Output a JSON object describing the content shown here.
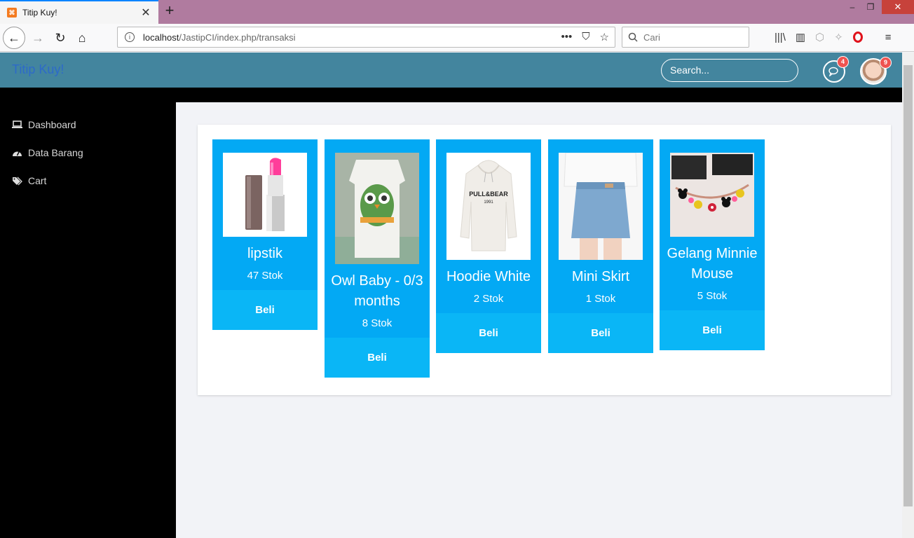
{
  "browser": {
    "tab_title": "Titip Kuy!",
    "url_host": "localhost",
    "url_path": "/JastipCI/index.php/transaksi",
    "search_placeholder": "Cari"
  },
  "app": {
    "brand": "Titip Kuy!",
    "search_placeholder": "Search...",
    "chat_badge": "4",
    "notif_badge": "9"
  },
  "sidebar": {
    "items": [
      {
        "label": "Dashboard",
        "icon": "laptop-icon"
      },
      {
        "label": "Data Barang",
        "icon": "dashboard-icon"
      },
      {
        "label": "Cart",
        "icon": "tags-icon"
      }
    ]
  },
  "products": [
    {
      "name": "lipstik",
      "stock": "47 Stok",
      "buy": "Beli"
    },
    {
      "name": "Owl Baby - 0/3 months",
      "stock": "8 Stok",
      "buy": "Beli"
    },
    {
      "name": "Hoodie White",
      "stock": "2 Stok",
      "buy": "Beli"
    },
    {
      "name": "Mini Skirt",
      "stock": "1 Stok",
      "buy": "Beli"
    },
    {
      "name": "Gelang Minnie Mouse",
      "stock": "5 Stok",
      "buy": "Beli"
    }
  ]
}
